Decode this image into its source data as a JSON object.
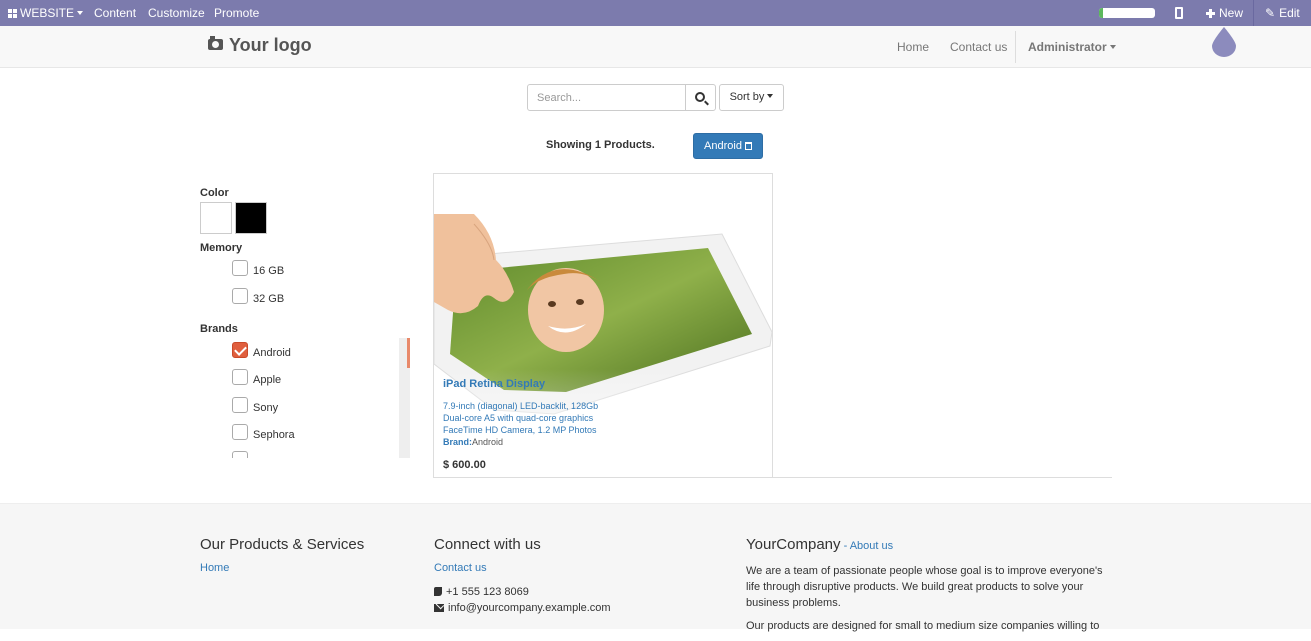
{
  "adminbar": {
    "website_label": "WEBSITE",
    "content_label": "Content",
    "customize_label": "Customize",
    "promote_label": "Promote",
    "progress_fraction": 0.08,
    "new_label": "New",
    "edit_label": "Edit"
  },
  "header": {
    "logo_text": "Your logo",
    "nav": {
      "home": "Home",
      "contact": "Contact us"
    },
    "user_label": "Administrator"
  },
  "search": {
    "placeholder": "Search...",
    "sort_label": "Sort by"
  },
  "results": {
    "showing_text": "Showing 1 Products.",
    "active_filter": "Android"
  },
  "filters": {
    "color_title": "Color",
    "colors": [
      "#ffffff",
      "#000000"
    ],
    "memory_title": "Memory",
    "memory_options": [
      {
        "label": "16 GB",
        "checked": false
      },
      {
        "label": "32 GB",
        "checked": false
      }
    ],
    "brands_title": "Brands",
    "brand_options": [
      {
        "label": "Android",
        "checked": true
      },
      {
        "label": "Apple",
        "checked": false
      },
      {
        "label": "Sony",
        "checked": false
      },
      {
        "label": "Sephora",
        "checked": false
      }
    ]
  },
  "product": {
    "name": "iPad Retina Display",
    "desc_lines": [
      "7.9-inch (diagonal) LED-backlit, 128Gb",
      "Dual-core A5 with quad-core graphics",
      "FaceTime HD Camera, 1.2 MP Photos"
    ],
    "brand_label": "Brand:",
    "brand_value": "Android",
    "price": "$ 600.00"
  },
  "footer": {
    "col1_title": "Our Products & Services",
    "col1_link": "Home",
    "col2_title": "Connect with us",
    "col2_link": "Contact us",
    "phone": "+1 555 123 8069",
    "email": "info@yourcompany.example.com",
    "col3_title": "YourCompany",
    "col3_link": "About us",
    "about_p1": "We are a team of passionate people whose goal is to improve everyone's life through disruptive products. We build great products to solve your business problems.",
    "about_p2": "Our products are designed for small to medium size companies willing to"
  },
  "colors": {
    "adminbar_bg": "#7c7bad",
    "primary": "#337ab7",
    "checkbox_accent": "#e05f3e"
  }
}
